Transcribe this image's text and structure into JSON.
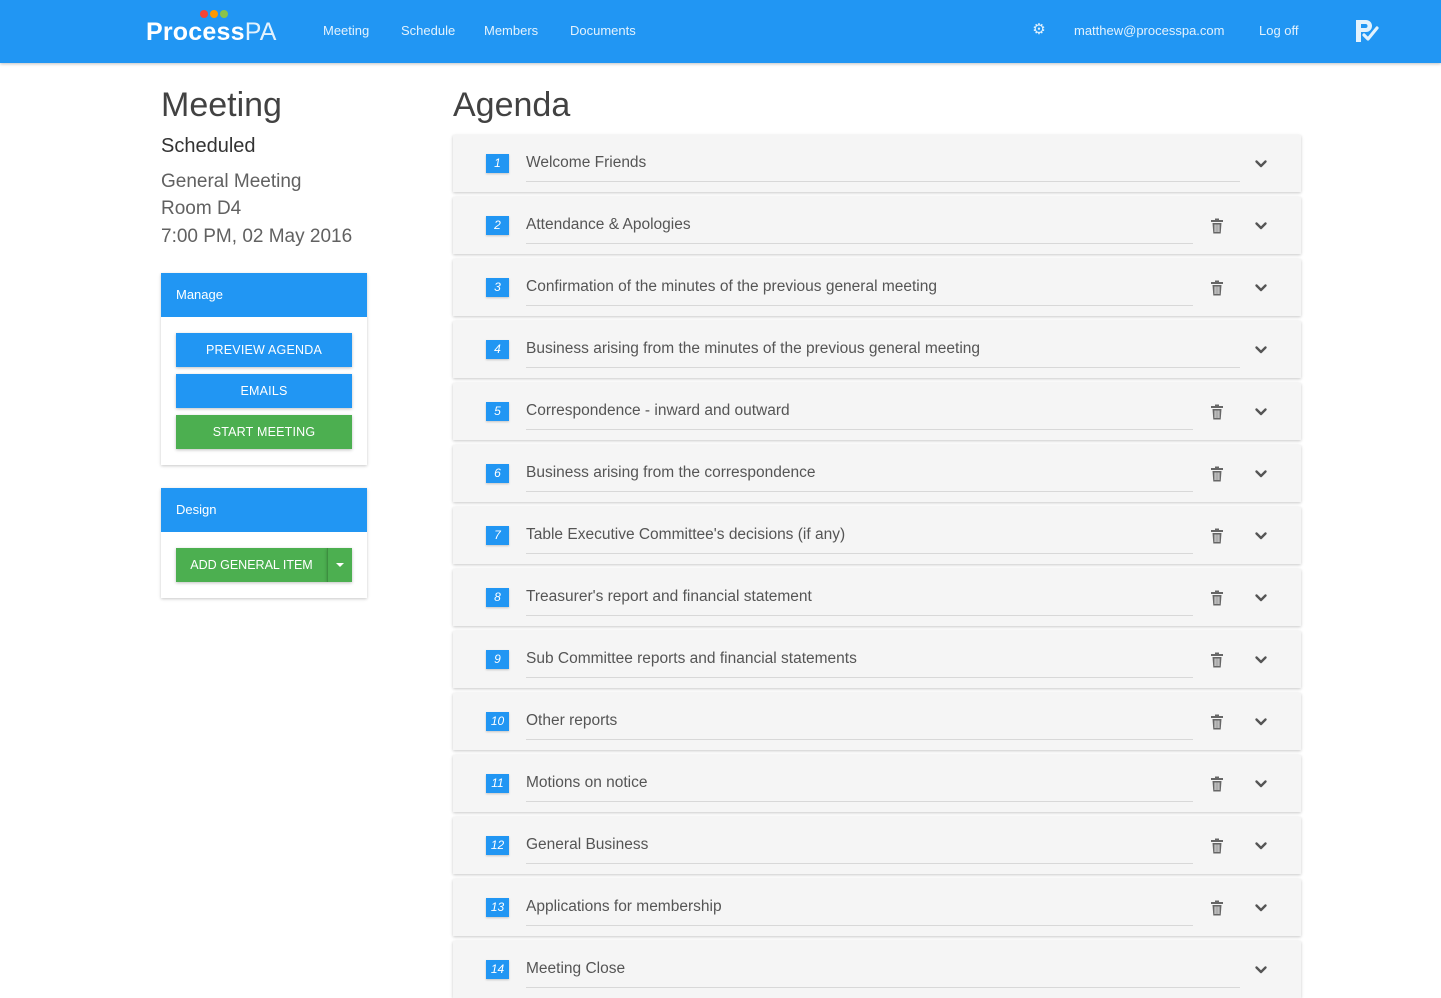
{
  "colors": {
    "primary": "#2196f3",
    "success": "#4caf50",
    "brand_dot_red": "#f44336",
    "brand_dot_orange": "#ff9800",
    "brand_dot_green": "#8bc34a"
  },
  "navbar": {
    "brand_bold": "Process",
    "brand_light": "PA",
    "links": [
      "Meeting",
      "Schedule",
      "Members",
      "Documents"
    ],
    "settings_icon": "gear-icon",
    "user_email": "matthew@processpa.com",
    "logout_label": "Log off",
    "app_icon": "processpa-logo-icon"
  },
  "meeting": {
    "title": "Meeting",
    "status": "Scheduled",
    "type": "General Meeting",
    "location": "Room D4",
    "datetime": "7:00 PM, 02 May 2016"
  },
  "manage_panel": {
    "heading": "Manage",
    "buttons": [
      "PREVIEW AGENDA",
      "EMAILS",
      "START MEETING"
    ]
  },
  "design_panel": {
    "heading": "Design",
    "add_button": "ADD GENERAL ITEM",
    "dropdown_icon": "caret-down-icon"
  },
  "agenda": {
    "title": "Agenda",
    "items": [
      {
        "number": "1",
        "title": "Welcome Friends",
        "deletable": false
      },
      {
        "number": "2",
        "title": "Attendance & Apologies",
        "deletable": true
      },
      {
        "number": "3",
        "title": "Confirmation of the minutes of the previous general meeting",
        "deletable": true
      },
      {
        "number": "4",
        "title": "Business arising from the minutes of the previous general meeting",
        "deletable": false
      },
      {
        "number": "5",
        "title": "Correspondence - inward and outward",
        "deletable": true
      },
      {
        "number": "6",
        "title": "Business arising from the correspondence",
        "deletable": true
      },
      {
        "number": "7",
        "title": "Table Executive Committee's decisions (if any)",
        "deletable": true
      },
      {
        "number": "8",
        "title": "Treasurer's report and financial statement",
        "deletable": true
      },
      {
        "number": "9",
        "title": "Sub Committee reports and financial statements",
        "deletable": true
      },
      {
        "number": "10",
        "title": "Other reports",
        "deletable": true
      },
      {
        "number": "11",
        "title": "Motions on notice",
        "deletable": true
      },
      {
        "number": "12",
        "title": "General Business",
        "deletable": true
      },
      {
        "number": "13",
        "title": "Applications for membership",
        "deletable": true
      },
      {
        "number": "14",
        "title": "Meeting Close",
        "deletable": false
      }
    ]
  }
}
